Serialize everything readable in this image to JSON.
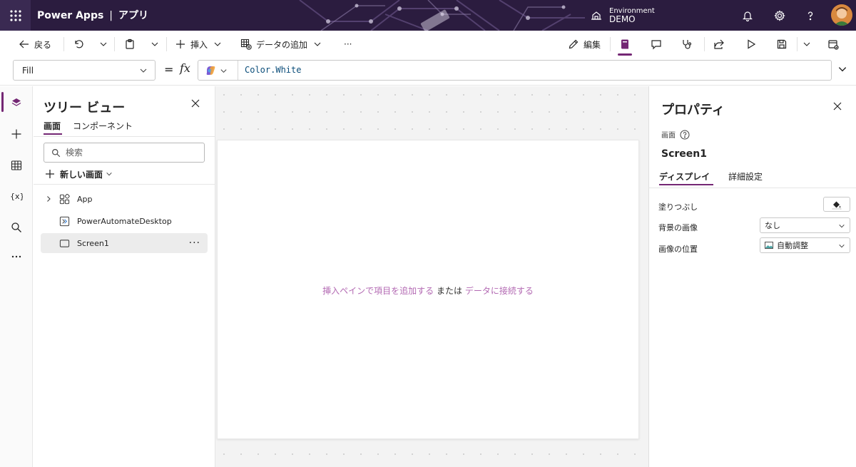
{
  "header": {
    "app_name": "Power Apps",
    "separator": "|",
    "app_title": "アプリ",
    "environment_label": "Environment",
    "environment_name": "DEMO",
    "icons": [
      "waffle-icon",
      "environment-icon",
      "bell-icon",
      "gear-icon",
      "help-icon",
      "avatar"
    ]
  },
  "commandbar": {
    "back_label": "戻る",
    "insert_label": "挿入",
    "add_data_label": "データの追加",
    "more_label": "···",
    "edit_label": "編集"
  },
  "formula": {
    "property": "Fill",
    "equals": "=",
    "fx": "fx",
    "value": "Color.White"
  },
  "tree": {
    "title": "ツリー ビュー",
    "tabs": [
      "画面",
      "コンポーネント"
    ],
    "search_placeholder": "検索",
    "new_screen_label": "新しい画面",
    "nodes": [
      {
        "label": "App"
      },
      {
        "label": "PowerAutomateDesktop"
      },
      {
        "label": "Screen1",
        "more": "···"
      }
    ]
  },
  "canvas": {
    "hint_link1": "挿入ペインで項目を追加する",
    "hint_or": "または",
    "hint_link2": "データに接続する"
  },
  "properties": {
    "title": "プロパティ",
    "screen_type": "画面",
    "screen_name": "Screen1",
    "tabs": [
      "ディスプレイ",
      "詳細設定"
    ],
    "fill_label": "塗りつぶし",
    "background_image_label": "背景の画像",
    "background_image_value": "なし",
    "image_position_label": "画像の位置",
    "image_position_value": "自動調整"
  },
  "colors": {
    "header_bg": "#2b1c3f",
    "accent": "#742774",
    "link": "#b36ab3"
  }
}
